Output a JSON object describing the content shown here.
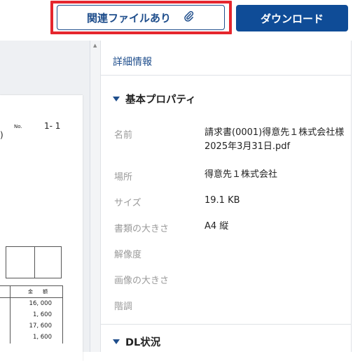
{
  "toolbar": {
    "related_files_label": "関連ファイルあり",
    "download_label": "ダウンロード"
  },
  "preview": {
    "no_label": "No.",
    "no_value": "1- 1",
    "paren": ")",
    "table_header_amount": "金　　額",
    "amounts": [
      "16, 000",
      "1, 600",
      "17, 600",
      "1, 600"
    ]
  },
  "details": {
    "title": "詳細情報",
    "basic_section": "基本プロパティ",
    "dl_section": "DL状況",
    "properties": [
      {
        "label": "名前",
        "value": "請求書(0001)得意先１株式会社様2025年3月31日.pdf"
      },
      {
        "label": "場所",
        "value": "得意先１株式会社"
      },
      {
        "label": "サイズ",
        "value": "19.1 KB"
      },
      {
        "label": "書類の大きさ",
        "value": "A4 縦"
      },
      {
        "label": "解像度",
        "value": ""
      },
      {
        "label": "画像の大きさ",
        "value": ""
      },
      {
        "label": "階調",
        "value": ""
      }
    ]
  },
  "colors": {
    "accent": "#1f4e8c",
    "primary_button": "#0f4c97",
    "highlight": "#e5262e"
  }
}
